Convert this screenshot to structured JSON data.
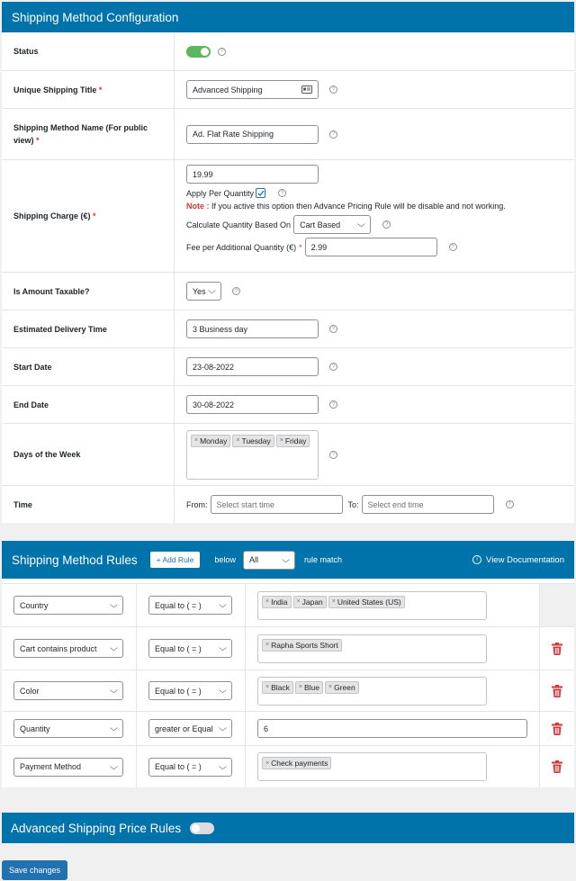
{
  "config": {
    "title": "Shipping Method Configuration",
    "status_label": "Status",
    "title_label": "Unique Shipping Title",
    "title_value": "Advanced Shipping",
    "name_label": "Shipping Method Name (For public view)",
    "name_value": "Ad. Flat Rate Shipping",
    "charge_label": "Shipping Charge (€)",
    "charge_value": "19.99",
    "apply_per_qty_label": "Apply Per Quantity",
    "note_label": "Note :",
    "note_text": "If you active this option then Advance Pricing Rule will be disable and not working.",
    "calc_label": "Calculate Quantity Based On",
    "calc_value": "Cart Based",
    "fee_label": "Fee per Additional Quantity (€)",
    "fee_value": "2.99",
    "taxable_label": "Is Amount Taxable?",
    "taxable_value": "Yes",
    "delivery_label": "Estimated Delivery Time",
    "delivery_value": "3 Business day",
    "start_label": "Start Date",
    "start_value": "23-08-2022",
    "end_label": "End Date",
    "end_value": "30-08-2022",
    "days_label": "Days of the Week",
    "days": [
      "Monday",
      "Tuesday",
      "Friday"
    ],
    "time_label": "Time",
    "from_label": "From:",
    "from_placeholder": "Select start time",
    "to_label": "To:",
    "to_placeholder": "Select end time",
    "required_mark": "*",
    "help_glyph": "?",
    "tag_remove_glyph": "×"
  },
  "rules": {
    "title": "Shipping Method Rules",
    "add_rule": "+ Add Rule",
    "below": "below",
    "match_value": "All",
    "rule_match": "rule match",
    "view_docs": "View Documentation",
    "rows": [
      {
        "field": "Country",
        "op": "Equal to ( = )",
        "values": [
          "India",
          "Japan",
          "United States (US)"
        ]
      },
      {
        "field": "Cart contains product",
        "op": "Equal to ( = )",
        "values": [
          "Rapha Sports Short"
        ]
      },
      {
        "field": "Color",
        "op": "Equal to ( = )",
        "values": [
          "Black",
          "Blue",
          "Green"
        ]
      },
      {
        "field": "Quantity",
        "op": "greater or Equal",
        "text": "6"
      },
      {
        "field": "Payment Method",
        "op": "Equal to ( = )",
        "values": [
          "Check payments"
        ]
      }
    ]
  },
  "advanced": {
    "title": "Advanced Shipping Price Rules"
  },
  "save_label": "Save changes",
  "colors": {
    "header": "#0073aa",
    "toggle_on": "#5cb85c",
    "delete": "#d63638",
    "button": "#2271b1"
  }
}
